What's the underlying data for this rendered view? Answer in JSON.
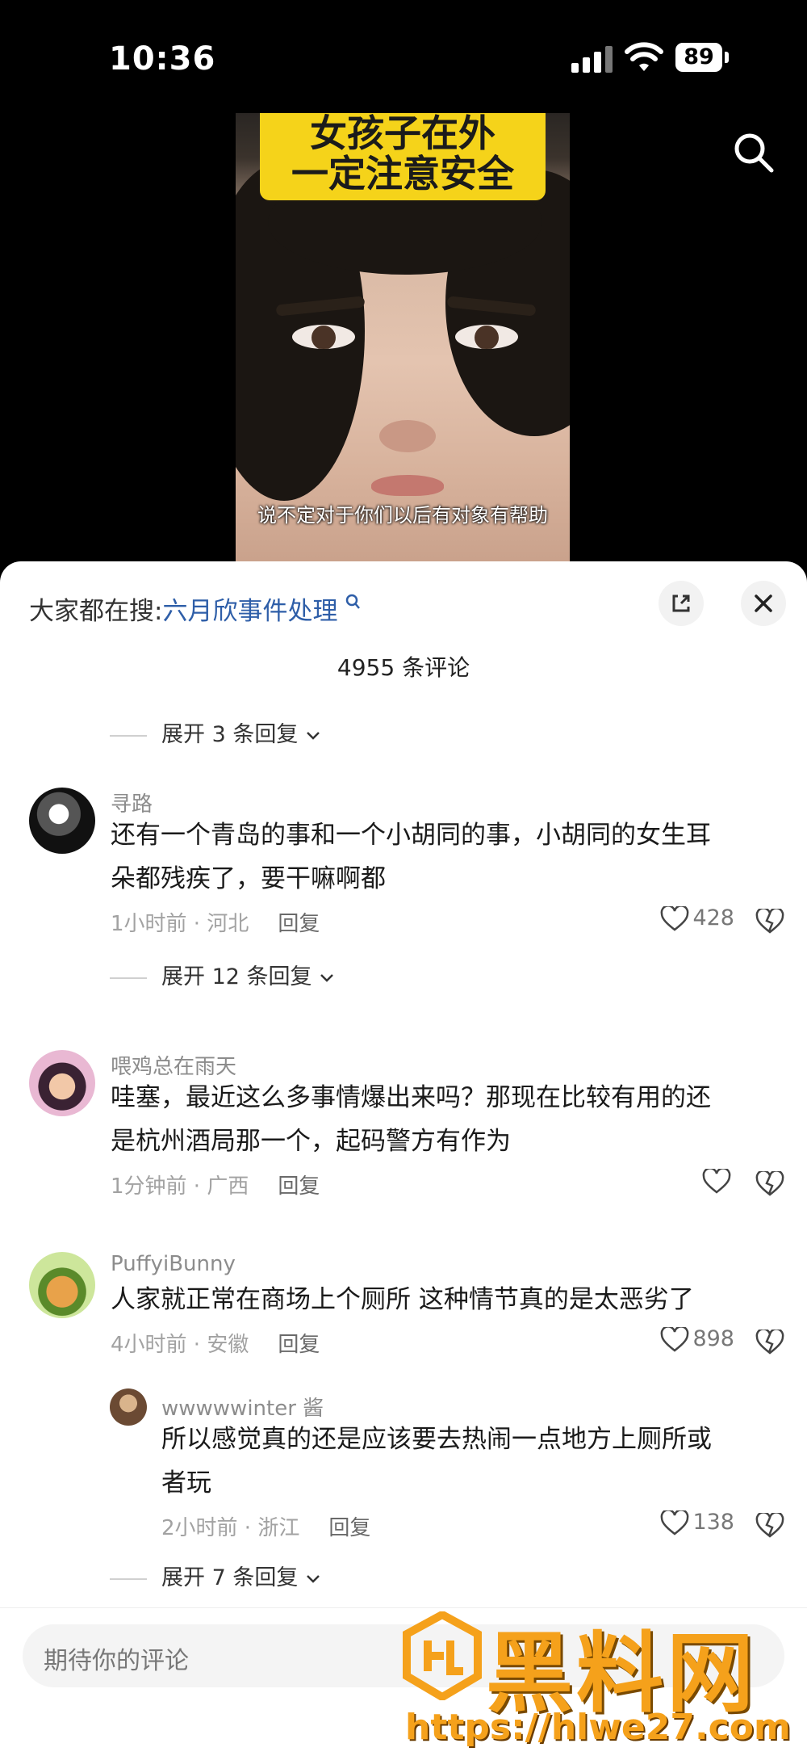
{
  "status_bar": {
    "time": "10:36",
    "battery": "89"
  },
  "video": {
    "caption_line1": "女孩子在外",
    "caption_line2": "一定注意安全",
    "subtitle": "说不定对于你们以后有对象有帮助"
  },
  "sheet": {
    "hot_prefix": "大家都在搜:",
    "hot_term": "六月欣事件处理",
    "comment_count": "4955 条评论"
  },
  "top_expand": "展开 3 条回复",
  "comments": [
    {
      "username": "寻路",
      "text_line1": "还有一个青岛的事和一个小胡同的事，小胡同的女生耳",
      "text_line2": "朵都残疾了，要干嘛啊都",
      "meta": "1小时前 · 河北",
      "reply": "回复",
      "likes": "428",
      "expand": "展开 12 条回复"
    },
    {
      "username": "喂鸡总在雨天",
      "text_line1": "哇塞，最近这么多事情爆出来吗？那现在比较有用的还",
      "text_line2": "是杭州酒局那一个，起码警方有作为",
      "meta": "1分钟前 · 广西",
      "reply": "回复",
      "likes": ""
    },
    {
      "username": "PuffyiBunny",
      "text_line1": "人家就正常在商场上个厕所 这种情节真的是太恶劣了",
      "meta": "4小时前 · 安徽",
      "reply": "回复",
      "likes": "898"
    }
  ],
  "sub_reply": {
    "username": "wwwwwinter 酱",
    "text_line1": "所以感觉真的还是应该要去热闹一点地方上厕所或",
    "text_line2": "者玩",
    "meta": "2小时前 · 浙江",
    "reply": "回复",
    "likes": "138",
    "expand": "展开 7 条回复"
  },
  "footer": {
    "placeholder": "期待你的评论"
  },
  "watermark": {
    "text": "黑料网",
    "url": "https://hlwe27.com"
  }
}
